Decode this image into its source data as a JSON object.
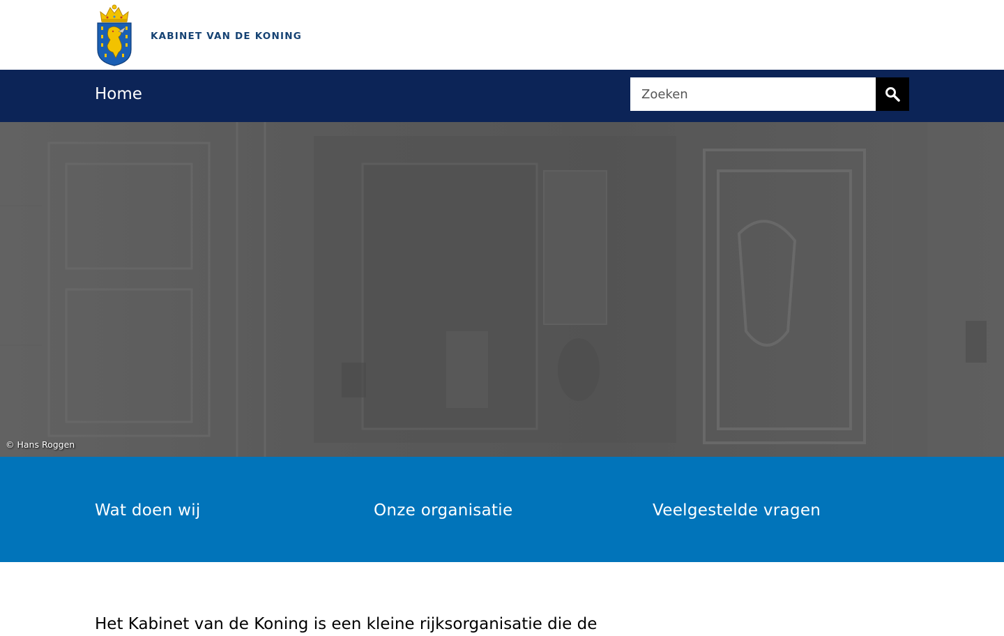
{
  "header": {
    "logo_text": "KABINET VAN DE KONING",
    "crest_icon": "royal-coat-of-arms-icon"
  },
  "nav": {
    "home_label": "Home",
    "search": {
      "placeholder": "Zoeken",
      "value": "",
      "button_icon": "search-icon"
    }
  },
  "hero": {
    "credit": "© Hans Roggen"
  },
  "quick_links": [
    {
      "label": "Wat doen wij"
    },
    {
      "label": "Onze organisatie"
    },
    {
      "label": "Veelgestelde vragen"
    }
  ],
  "intro": {
    "text": "Het Kabinet van de Koning is een kleine rijksorganisatie die de"
  },
  "colors": {
    "logo_blue": "#154273",
    "nav_bg": "#0c2457",
    "band_bg": "#0174ba",
    "search_button_bg": "#000000",
    "crest_gold": "#f2c200",
    "crest_blue": "#1a5fb4"
  }
}
